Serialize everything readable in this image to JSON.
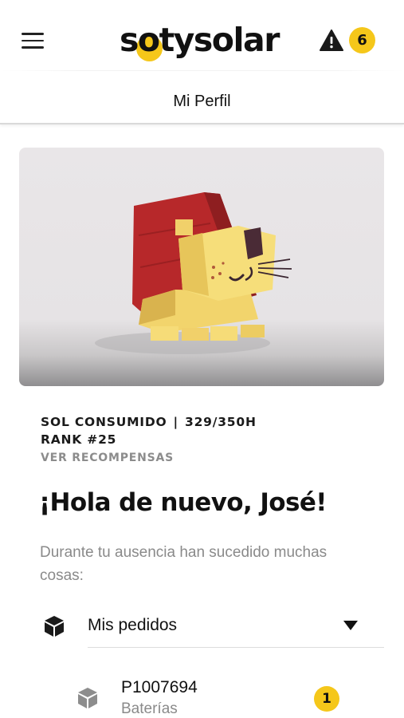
{
  "header": {
    "brand": "sotysolar",
    "notifications_count": "6",
    "icons": {
      "menu": "hamburger-menu-icon",
      "alert": "warning-triangle-icon"
    },
    "accent_color": "#f5c71a"
  },
  "page": {
    "title": "Mi Perfil"
  },
  "stats": {
    "sol_label": "SOL CONSUMIDO",
    "separator": "|",
    "sol_value": "329/350H",
    "rank": "RANK #25",
    "rewards_link": "VER RECOMPENSAS"
  },
  "greeting": {
    "title": "¡Hola de nuevo, José!",
    "subtitle": "Durante tu ausencia han sucedido muchas cosas:"
  },
  "orders": {
    "label": "Mis pedidos",
    "items": [
      {
        "id": "P1007694",
        "category": "Baterías",
        "badge": "1"
      }
    ]
  }
}
